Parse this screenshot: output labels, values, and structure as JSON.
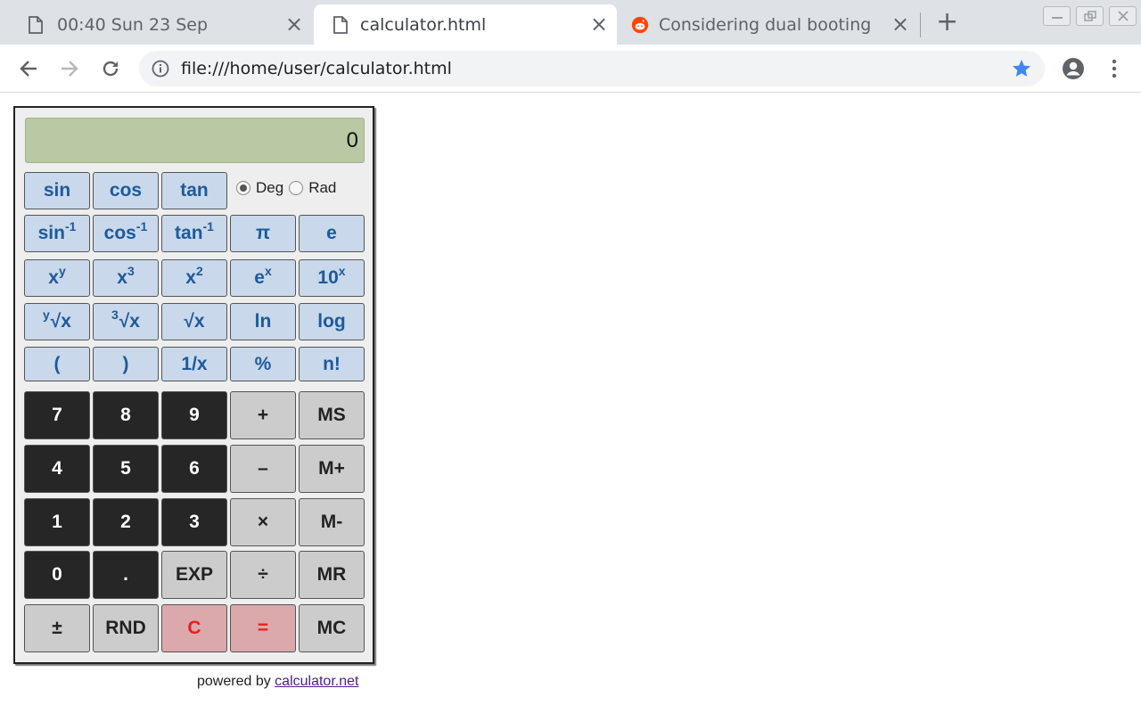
{
  "browser": {
    "tabs": [
      {
        "title": "00:40 Sun 23 Sep",
        "icon": "document-icon"
      },
      {
        "title": "calculator.html",
        "icon": "document-icon"
      },
      {
        "title": "Considering dual booting L",
        "icon": "reddit-icon"
      }
    ],
    "address": "file:///home/user/calculator.html",
    "accent_color": "#4285f4"
  },
  "calculator": {
    "display_value": "0",
    "angle_modes": [
      "Deg",
      "Rad"
    ],
    "selected_mode": "Deg",
    "trig": [
      "sin",
      "cos",
      "tan"
    ],
    "inverse": [
      {
        "base": "sin",
        "sup": "-1"
      },
      {
        "base": "cos",
        "sup": "-1"
      },
      {
        "base": "tan",
        "sup": "-1"
      },
      {
        "base": "π"
      },
      {
        "base": "e"
      }
    ],
    "powers": [
      {
        "base": "x",
        "sup": "y"
      },
      {
        "base": "x",
        "sup": "3"
      },
      {
        "base": "x",
        "sup": "2"
      },
      {
        "base": "e",
        "sup": "x"
      },
      {
        "base": "10",
        "sup": "x"
      }
    ],
    "roots": [
      {
        "pre": "y",
        "base": "√x"
      },
      {
        "pre": "3",
        "base": "√x"
      },
      {
        "base": "√x"
      },
      {
        "base": "ln"
      },
      {
        "base": "log"
      }
    ],
    "misc": [
      "(",
      ")",
      "1/x",
      "%",
      "n!"
    ],
    "keypad_rows": [
      [
        "7",
        "8",
        "9",
        "+",
        "MS"
      ],
      [
        "4",
        "5",
        "6",
        "–",
        "M+"
      ],
      [
        "1",
        "2",
        "3",
        "×",
        "M-"
      ],
      [
        "0",
        ".",
        "EXP",
        "÷",
        "MR"
      ],
      [
        "±",
        "RND",
        "C",
        "=",
        "MC"
      ]
    ],
    "colors": {
      "display": "#b8c9a4",
      "scientific": "#c9d8ea",
      "scientific_text": "#1d5a9c",
      "digit": "#262626",
      "operator": "#cccccc",
      "clear_equals": "#dba8ab",
      "clear_equals_text": "#e8201b"
    }
  },
  "footer": {
    "prefix": "powered by",
    "link": "calculator.net"
  }
}
